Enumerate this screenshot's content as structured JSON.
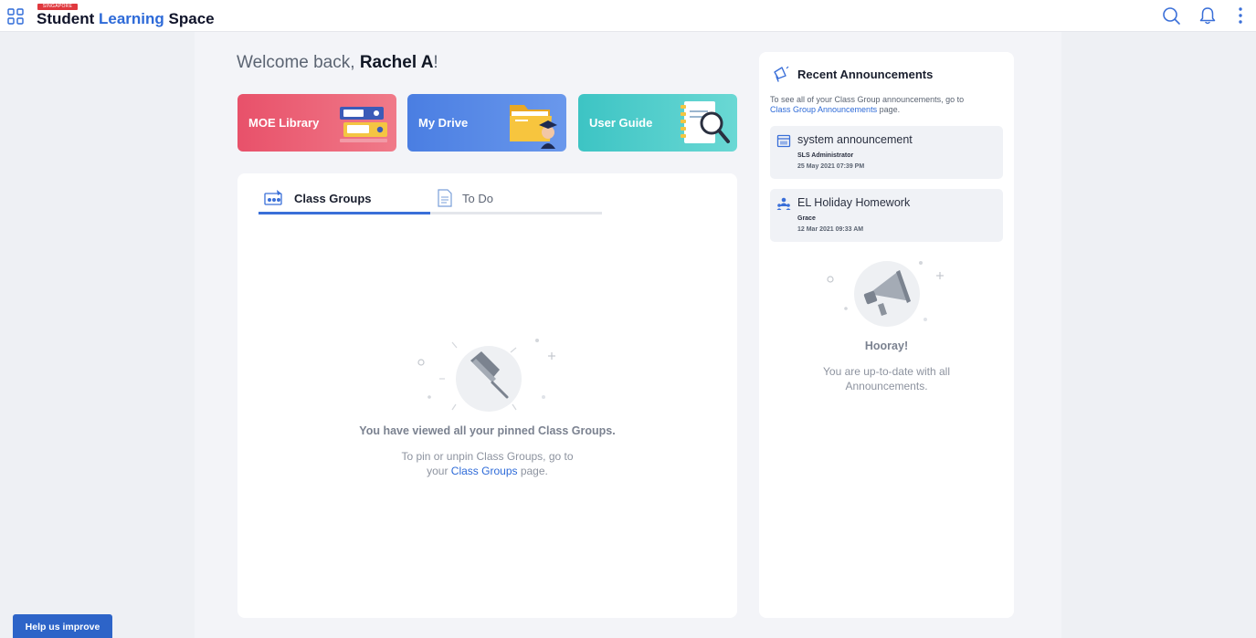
{
  "header": {
    "brand_flag": "SINGAPORE",
    "brand_word1": "Student",
    "brand_word2": "Learning",
    "brand_word3": "Space",
    "icons": [
      "apps-grid-icon",
      "search-icon",
      "bell-icon",
      "kebab-menu-icon"
    ]
  },
  "welcome": {
    "prefix": "Welcome back, ",
    "name": "Rachel A",
    "suffix": "!"
  },
  "quick_links": [
    {
      "label": "MOE Library",
      "icon": "binders-icon",
      "color": "#e8516a"
    },
    {
      "label": "My Drive",
      "icon": "folder-icon",
      "color": "#4a7ee2"
    },
    {
      "label": "User Guide",
      "icon": "magnifier-notebook-icon",
      "color": "#3dc4c4"
    }
  ],
  "tabs": [
    {
      "label": "Class Groups",
      "icon": "class-groups-icon",
      "active": true
    },
    {
      "label": "To Do",
      "icon": "todo-icon",
      "active": false
    }
  ],
  "class_groups_empty": {
    "title": "You have viewed all your pinned Class Groups.",
    "desc_line1": "To pin or unpin Class Groups, go to",
    "desc_prefix": "your ",
    "desc_link": "Class Groups",
    "desc_suffix": " page."
  },
  "announcements": {
    "title": "Recent Announcements",
    "intro_text": "To see all of your Class Group announcements, go to",
    "intro_link": "Class Group Announcements",
    "intro_suffix": " page.",
    "items": [
      {
        "title": "system announcement",
        "author": "SLS Administrator",
        "date": "25 May 2021 07:39 PM",
        "icon": "calendar-icon"
      },
      {
        "title": "EL Holiday Homework",
        "author": "Grace",
        "date": "12 Mar 2021 09:33 AM",
        "icon": "group-icon"
      }
    ],
    "empty_title": "Hooray!",
    "empty_desc": "You are up-to-date with all Announcements."
  },
  "help_button": "Help us improve",
  "colors": {
    "accent": "#2d6ad8",
    "help_button": "#2d64c8",
    "page_bg": "#eef0f4"
  }
}
